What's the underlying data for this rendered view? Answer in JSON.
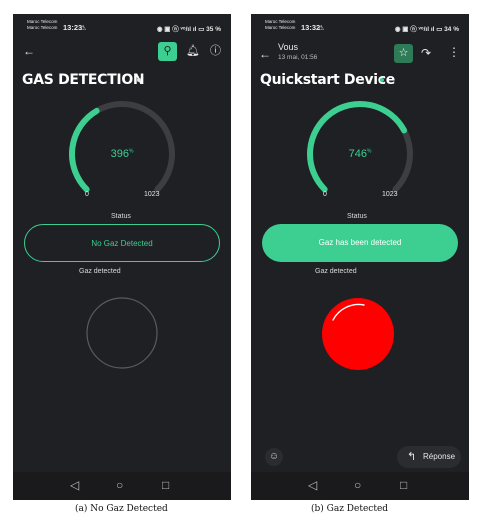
{
  "accent": "#3ccf91",
  "screens": [
    {
      "status": {
        "carrier_line1": "Maroc Telecom",
        "carrier_line2": "Maroc Telecom",
        "time": "13:23",
        "icons": "◉ ▣ ⓝ ᵛᵒ/ıl ıl ▭ 35 %"
      },
      "icons": {
        "back": "back-arrow-icon",
        "wand": "magic-wand-icon",
        "bell": "bell-icon",
        "info": "info-icon"
      },
      "title": "GAS DETECTION",
      "title_dot_color": "#e6e6e6",
      "gauge": {
        "value": "396",
        "unit": "%",
        "min": "0",
        "max": "1023",
        "fraction": 0.387
      },
      "status_label": "Status",
      "status_button": "No Gaz Detected",
      "gas_label": "Gaz detected",
      "indicator": "off",
      "nav": {
        "back": "◁",
        "home": "○",
        "recents": "□"
      }
    },
    {
      "status": {
        "carrier_line1": "Maroc Telecom",
        "carrier_line2": "Maroc Telecom",
        "time": "13:32",
        "icons": "◉ ▣ ⓝ ᵛᵒ/ıl ıl ▭ 34 %"
      },
      "sender": {
        "name": "Vous",
        "date": "13 mai, 01:56"
      },
      "icons": {
        "back": "back-arrow-icon",
        "star": "star-icon",
        "share": "share-icon",
        "more": "more-vertical-icon"
      },
      "title": "Quickstart Device",
      "title_dot_color": "#3ccf91",
      "gauge": {
        "value": "746",
        "unit": "%",
        "min": "0",
        "max": "1023",
        "fraction": 0.729
      },
      "status_label": "Status",
      "status_button": "Gaz has been detected",
      "gas_label": "Gaz detected",
      "indicator": "on",
      "reply_label": "Réponse",
      "nav": {
        "back": "◁",
        "home": "○",
        "recents": "□"
      }
    }
  ],
  "captions": [
    "(a) No Gaz Detected",
    "(b) Gaz Detected"
  ]
}
